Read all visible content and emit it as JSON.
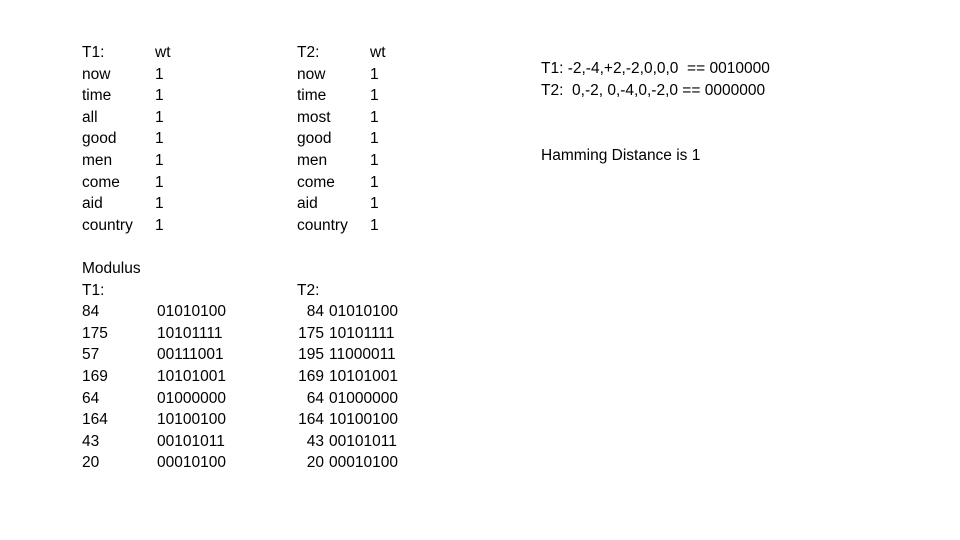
{
  "term_tables": {
    "t1": {
      "label": "T1:",
      "weight_header": "wt",
      "rows": [
        {
          "term": "now",
          "wt": "1"
        },
        {
          "term": "time",
          "wt": "1"
        },
        {
          "term": "all",
          "wt": "1"
        },
        {
          "term": "good",
          "wt": "1"
        },
        {
          "term": "men",
          "wt": "1"
        },
        {
          "term": "come",
          "wt": "1"
        },
        {
          "term": "aid",
          "wt": "1"
        },
        {
          "term": "country",
          "wt": "1"
        }
      ]
    },
    "t2": {
      "label": "T2:",
      "weight_header": "wt",
      "rows": [
        {
          "term": "now",
          "wt": "1"
        },
        {
          "term": "time",
          "wt": "1"
        },
        {
          "term": "most",
          "wt": "1"
        },
        {
          "term": "good",
          "wt": "1"
        },
        {
          "term": "men",
          "wt": "1"
        },
        {
          "term": "come",
          "wt": "1"
        },
        {
          "term": "aid",
          "wt": "1"
        },
        {
          "term": "country",
          "wt": "1"
        }
      ]
    }
  },
  "modulus": {
    "heading": "Modulus",
    "t1": {
      "label": "T1:",
      "rows": [
        {
          "dec": "84",
          "bin": "01010100"
        },
        {
          "dec": "175",
          "bin": "10101111"
        },
        {
          "dec": "57",
          "bin": "00111001"
        },
        {
          "dec": "169",
          "bin": "10101001"
        },
        {
          "dec": "64",
          "bin": "01000000"
        },
        {
          "dec": "164",
          "bin": "10100100"
        },
        {
          "dec": "43",
          "bin": "00101011"
        },
        {
          "dec": "20",
          "bin": "00010100"
        }
      ]
    },
    "t2": {
      "label": "T2:",
      "rows": [
        {
          "dec": "84",
          "bin": "01010100"
        },
        {
          "dec": "175",
          "bin": "10101111"
        },
        {
          "dec": "195",
          "bin": "11000011"
        },
        {
          "dec": "169",
          "bin": "10101001"
        },
        {
          "dec": "64",
          "bin": "01000000"
        },
        {
          "dec": "164",
          "bin": "10100100"
        },
        {
          "dec": "43",
          "bin": "00101011"
        },
        {
          "dec": "20",
          "bin": "00010100"
        }
      ]
    }
  },
  "summary": {
    "lines": [
      {
        "label": "T1:",
        "vector": " -2,-4,+2,-2,0,0,0 ",
        "operator": " == ",
        "signature": "0010000"
      },
      {
        "label": "T2:",
        "vector": "  0,-2, 0,-4,0,-2,0",
        "operator": " == ",
        "signature": "0000000"
      }
    ],
    "hamming_distance_text": "Hamming Distance is 1"
  }
}
